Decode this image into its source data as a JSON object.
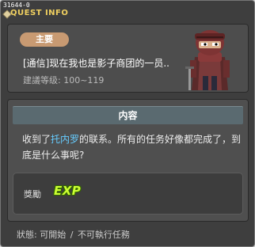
{
  "quest_id": "31644-0",
  "window_title": "QUEST INFO",
  "header": {
    "badge": "主要",
    "quest_name": "[通信]现在我也是影子商团的一员..",
    "required_level": "建議等级: 100~119"
  },
  "content": {
    "section_title": "内容",
    "text_before": "收到了",
    "npc_name": "托内罗",
    "text_after": "的联系。所有的任务好像都完成了，到底是什么事呢?"
  },
  "reward": {
    "label": "獎勵",
    "exp_label": "EXP"
  },
  "status": {
    "label": "狀態:",
    "start": "可開始",
    "separator": "/",
    "state": "不可執行任務"
  },
  "colors": {
    "window_bg": "#3e3e3e",
    "title": "#f0d060",
    "badge": "#c89a72",
    "npc_link": "#66ccff",
    "exp": "#ccff33"
  }
}
